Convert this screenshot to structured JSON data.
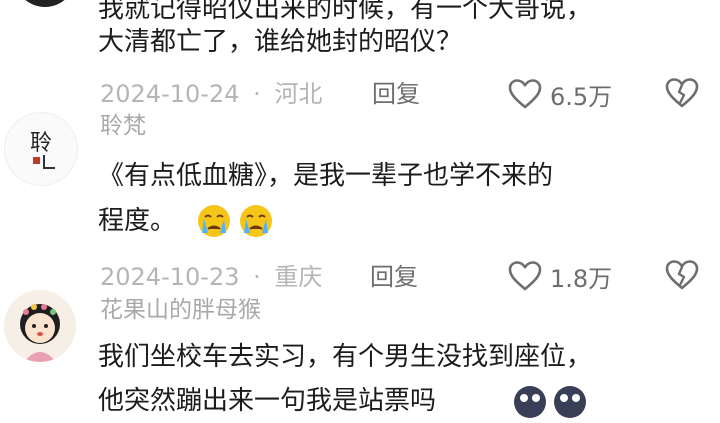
{
  "comments": [
    {
      "line1": "我就记得昭仪出来的时候，有一个大哥说，",
      "line2": "大清都亡了，谁给她封的昭仪？",
      "date": "2024-10-24",
      "location": "河北",
      "reply_label": "回复",
      "likes": "6.5万"
    },
    {
      "username": "聆梵",
      "avatar_text": "聆",
      "line1": "《有点低血糖》，是我一辈子也学不来的",
      "line2": "程度。",
      "date": "2024-10-23",
      "location": "重庆",
      "reply_label": "回复",
      "likes": "1.8万"
    },
    {
      "username": "花果山的胖母猴",
      "line1": "我们坐校车去实习，有个男生没找到座位，",
      "line2": "他突然蹦出来一句我是站票吗"
    }
  ],
  "separator": "·",
  "colors": {
    "text": "#1c1c1c",
    "meta": "#b5b5b5",
    "action": "#6e6e6e",
    "emoji_face": "#f5c518",
    "emoji_tear": "#4fb3ff"
  },
  "icons": [
    "heart-icon",
    "dislike-heart-icon",
    "crying-emoji-icon",
    "dark-emoji-icon"
  ]
}
